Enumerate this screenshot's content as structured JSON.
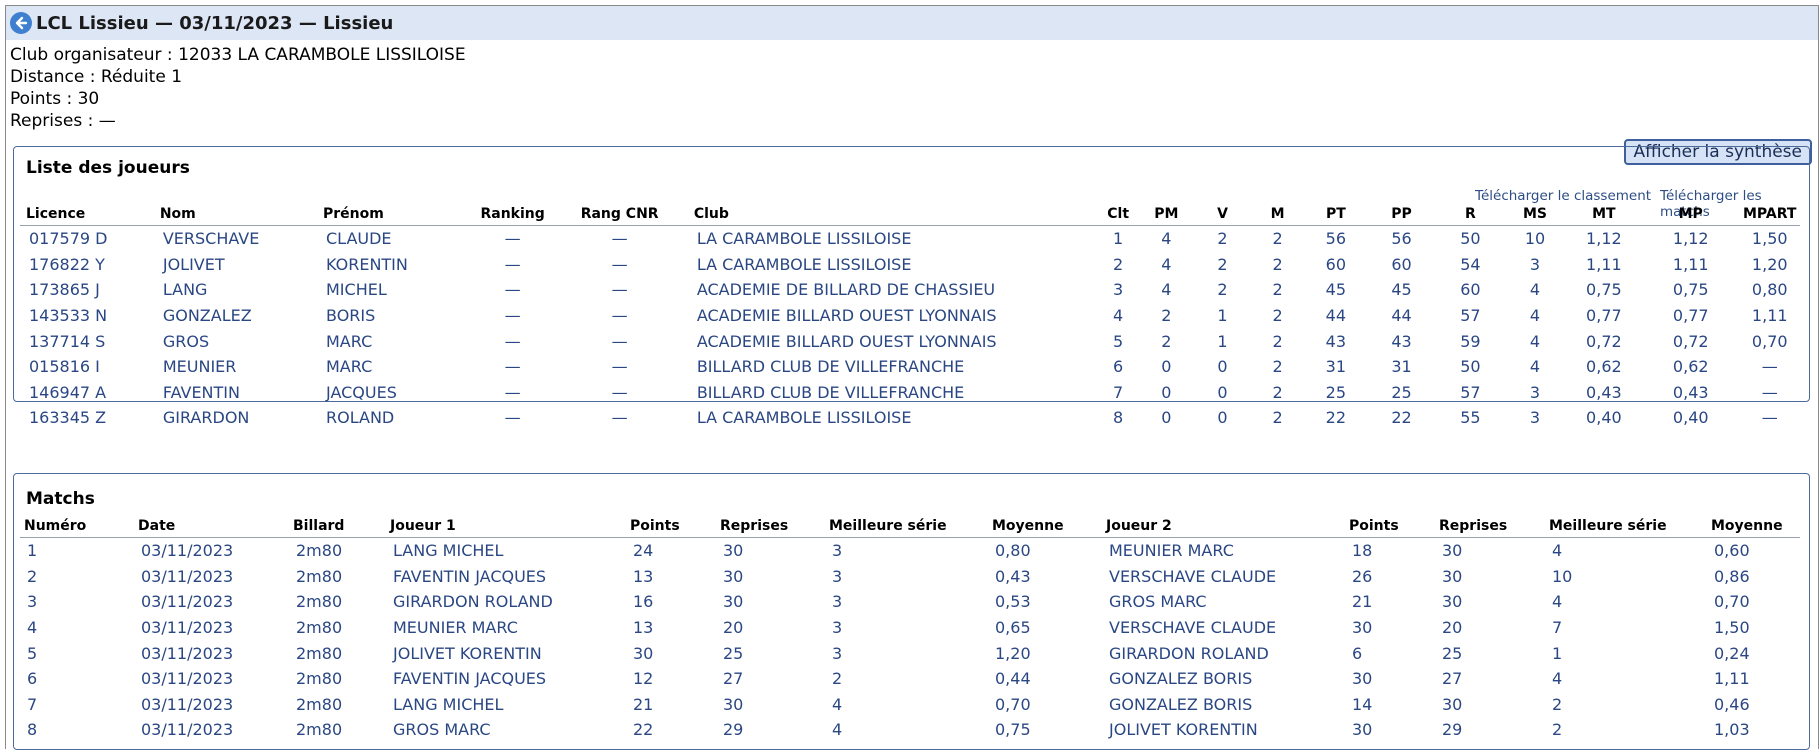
{
  "header": {
    "title": "LCL Lissieu — 03/11/2023 — Lissieu"
  },
  "info": {
    "club_label": "Club organisateur : ",
    "club_value": "12033 LA CARAMBOLE LISSILOISE",
    "distance_label": "Distance : ",
    "distance_value": "Réduite 1",
    "points_label": "Points : ",
    "points_value": "30",
    "reprises_label": "Reprises : ",
    "reprises_value": "—"
  },
  "synthese_button": "Afficher la synthèse",
  "players": {
    "title": "Liste des joueurs",
    "download_classement": "Télécharger le classement",
    "download_matchs": "Télécharger les matchs",
    "columns": [
      "Licence",
      "Nom",
      "Prénom",
      "Ranking",
      "Rang CNR",
      "Club",
      "Clt",
      "PM",
      "V",
      "M",
      "PT",
      "PP",
      "R",
      "MS",
      "MT",
      "MP",
      "MPART"
    ],
    "rows": [
      [
        "017579 D",
        "VERSCHAVE",
        "CLAUDE",
        "—",
        "—",
        "LA CARAMBOLE LISSILOISE",
        "1",
        "4",
        "2",
        "2",
        "56",
        "56",
        "50",
        "10",
        "1,12",
        "1,12",
        "1,50"
      ],
      [
        "176822 Y",
        "JOLIVET",
        "KORENTIN",
        "—",
        "—",
        "LA CARAMBOLE LISSILOISE",
        "2",
        "4",
        "2",
        "2",
        "60",
        "60",
        "54",
        "3",
        "1,11",
        "1,11",
        "1,20"
      ],
      [
        "173865 J",
        "LANG",
        "MICHEL",
        "—",
        "—",
        "ACADEMIE DE BILLARD DE CHASSIEU",
        "3",
        "4",
        "2",
        "2",
        "45",
        "45",
        "60",
        "4",
        "0,75",
        "0,75",
        "0,80"
      ],
      [
        "143533 N",
        "GONZALEZ",
        "BORIS",
        "—",
        "—",
        "ACADEMIE BILLARD OUEST LYONNAIS",
        "4",
        "2",
        "1",
        "2",
        "44",
        "44",
        "57",
        "4",
        "0,77",
        "0,77",
        "1,11"
      ],
      [
        "137714 S",
        "GROS",
        "MARC",
        "—",
        "—",
        "ACADEMIE BILLARD OUEST LYONNAIS",
        "5",
        "2",
        "1",
        "2",
        "43",
        "43",
        "59",
        "4",
        "0,72",
        "0,72",
        "0,70"
      ],
      [
        "015816 I",
        "MEUNIER",
        "MARC",
        "—",
        "—",
        "BILLARD CLUB DE VILLEFRANCHE",
        "6",
        "0",
        "0",
        "2",
        "31",
        "31",
        "50",
        "4",
        "0,62",
        "0,62",
        "—"
      ],
      [
        "146947 A",
        "FAVENTIN",
        "JACQUES",
        "—",
        "—",
        "BILLARD CLUB DE VILLEFRANCHE",
        "7",
        "0",
        "0",
        "2",
        "25",
        "25",
        "57",
        "3",
        "0,43",
        "0,43",
        "—"
      ],
      [
        "163345 Z",
        "GIRARDON",
        "ROLAND",
        "—",
        "—",
        "LA CARAMBOLE LISSILOISE",
        "8",
        "0",
        "0",
        "2",
        "22",
        "22",
        "55",
        "3",
        "0,40",
        "0,40",
        "—"
      ]
    ]
  },
  "matchs": {
    "title": "Matchs",
    "columns": [
      "Numéro",
      "Date",
      "Billard",
      "Joueur 1",
      "Points",
      "Reprises",
      "Meilleure série",
      "Moyenne",
      "Joueur 2",
      "Points",
      "Reprises",
      "Meilleure série",
      "Moyenne"
    ],
    "rows": [
      [
        "1",
        "03/11/2023",
        "2m80",
        "LANG MICHEL",
        "24",
        "30",
        "3",
        "0,80",
        "MEUNIER MARC",
        "18",
        "30",
        "4",
        "0,60"
      ],
      [
        "2",
        "03/11/2023",
        "2m80",
        "FAVENTIN JACQUES",
        "13",
        "30",
        "3",
        "0,43",
        "VERSCHAVE CLAUDE",
        "26",
        "30",
        "10",
        "0,86"
      ],
      [
        "3",
        "03/11/2023",
        "2m80",
        "GIRARDON ROLAND",
        "16",
        "30",
        "3",
        "0,53",
        "GROS MARC",
        "21",
        "30",
        "4",
        "0,70"
      ],
      [
        "4",
        "03/11/2023",
        "2m80",
        "MEUNIER MARC",
        "13",
        "20",
        "3",
        "0,65",
        "VERSCHAVE CLAUDE",
        "30",
        "20",
        "7",
        "1,50"
      ],
      [
        "5",
        "03/11/2023",
        "2m80",
        "JOLIVET KORENTIN",
        "30",
        "25",
        "3",
        "1,20",
        "GIRARDON ROLAND",
        "6",
        "25",
        "1",
        "0,24"
      ],
      [
        "6",
        "03/11/2023",
        "2m80",
        "FAVENTIN JACQUES",
        "12",
        "27",
        "2",
        "0,44",
        "GONZALEZ BORIS",
        "30",
        "27",
        "4",
        "1,11"
      ],
      [
        "7",
        "03/11/2023",
        "2m80",
        "LANG MICHEL",
        "21",
        "30",
        "4",
        "0,70",
        "GONZALEZ BORIS",
        "14",
        "30",
        "2",
        "0,46"
      ],
      [
        "8",
        "03/11/2023",
        "2m80",
        "GROS MARC",
        "22",
        "29",
        "4",
        "0,75",
        "JOLIVET KORENTIN",
        "30",
        "29",
        "2",
        "1,03"
      ]
    ]
  }
}
